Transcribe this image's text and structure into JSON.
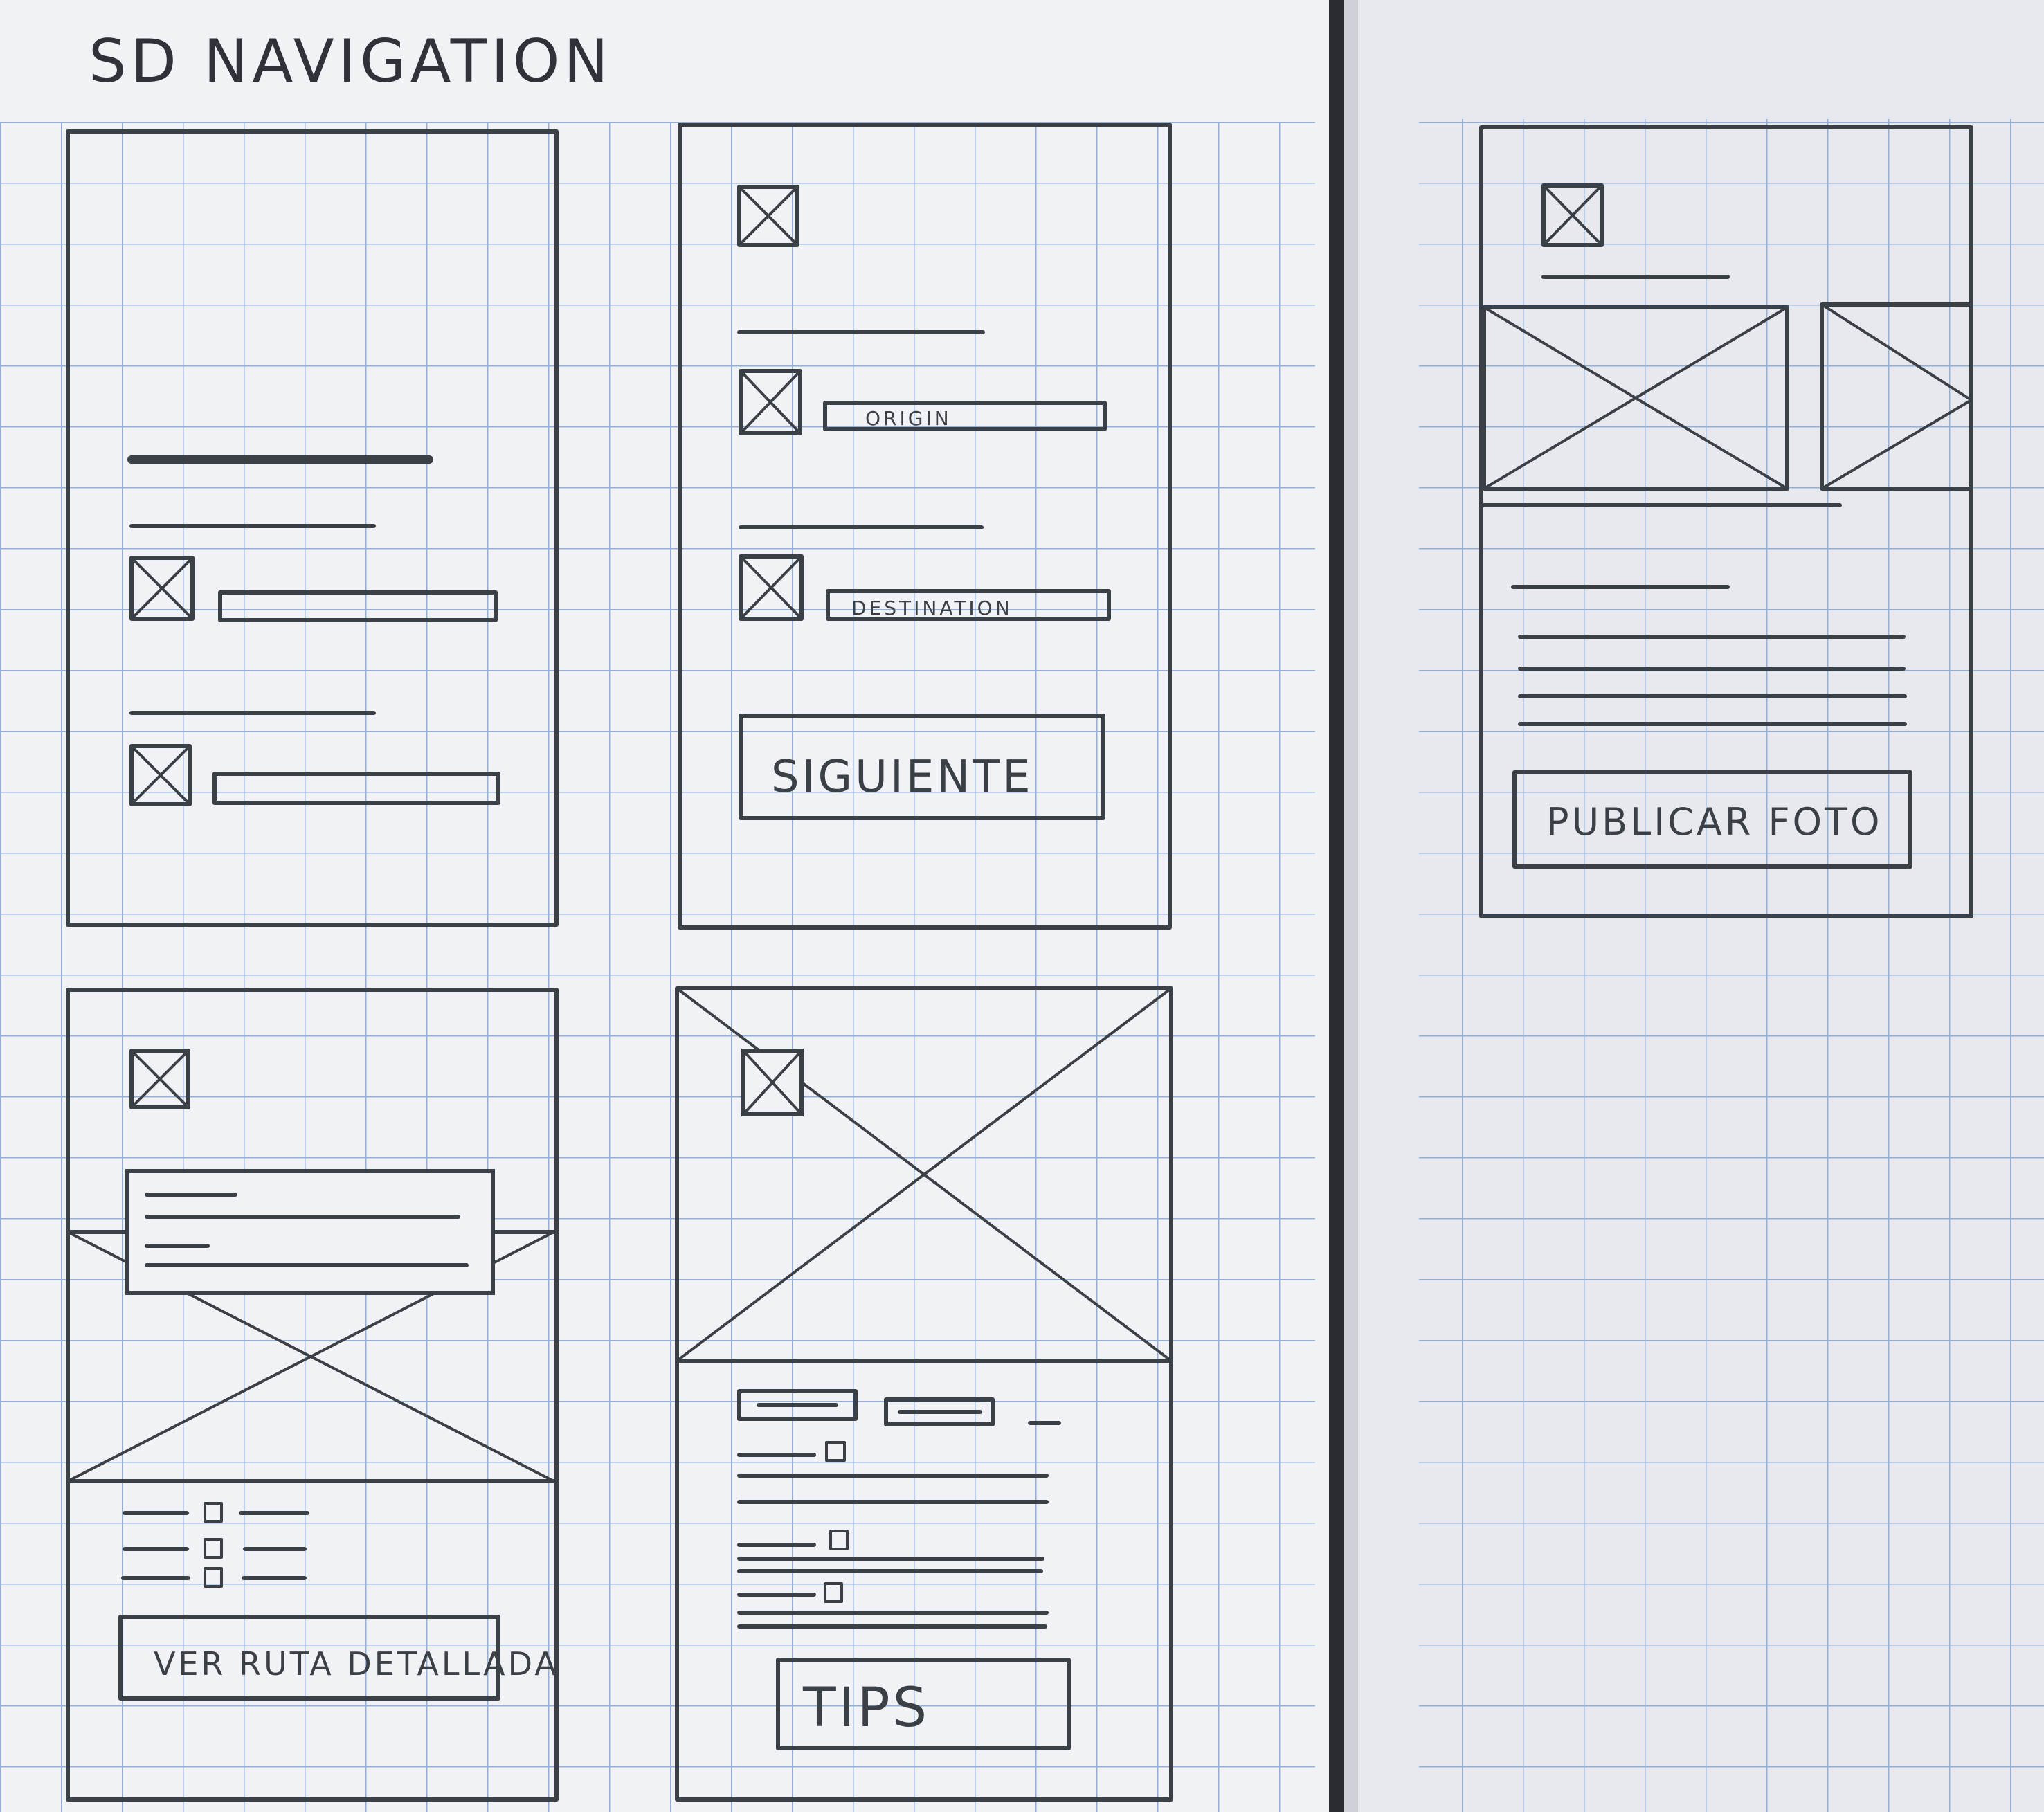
{
  "title": "SD NAVIGATION",
  "colors": {
    "paper_left": "#f1f2f6",
    "paper_right": "#e7e8ee",
    "grid": "#8fb0d8",
    "pencil": "#3b3f46",
    "gutter": "#1a1c20"
  },
  "screens": {
    "screen2": {
      "field1_label": "ORIGIN",
      "field2_label": "DESTINATION",
      "button_label": "SIGUIENTE"
    },
    "screen3": {
      "button_label": "PUBLICAR FOTO"
    },
    "screen4": {
      "button_label": "VER RUTA DETALLADA"
    },
    "screen5": {
      "button_label": "TIPS"
    }
  }
}
